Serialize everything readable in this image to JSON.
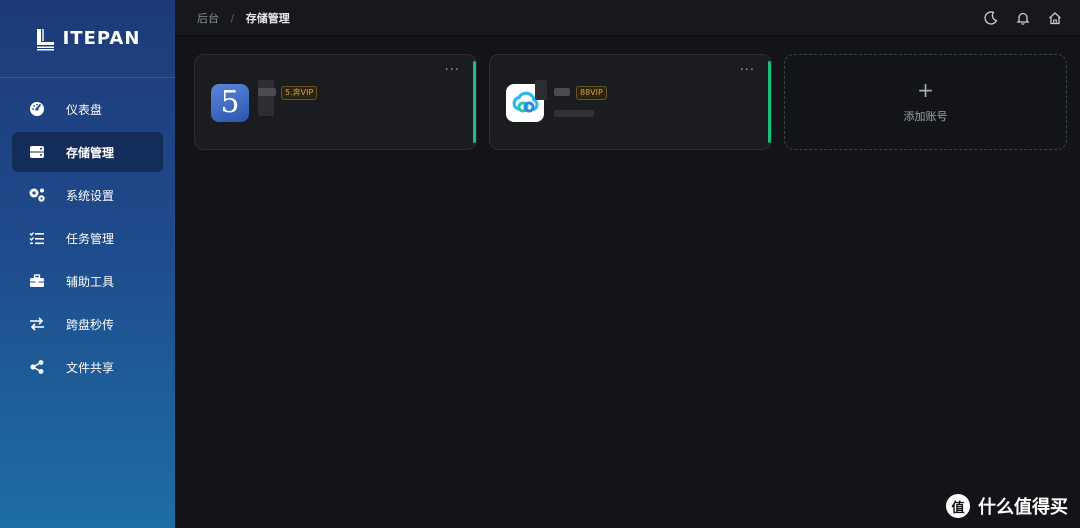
{
  "brand": {
    "logo_text": "ITEPAN"
  },
  "sidebar": {
    "items": [
      {
        "label": "仪表盘",
        "icon": "dashboard-icon",
        "active": false
      },
      {
        "label": "存储管理",
        "icon": "storage-icon",
        "active": true
      },
      {
        "label": "系统设置",
        "icon": "gears-icon",
        "active": false
      },
      {
        "label": "任务管理",
        "icon": "task-list-icon",
        "active": false
      },
      {
        "label": "辅助工具",
        "icon": "toolbox-icon",
        "active": false
      },
      {
        "label": "跨盘秒传",
        "icon": "transfer-icon",
        "active": false
      },
      {
        "label": "文件共享",
        "icon": "share-icon",
        "active": false
      }
    ]
  },
  "header": {
    "breadcrumb": [
      "后台",
      "存储管理"
    ],
    "separator": "/",
    "icons": [
      "moon-icon",
      "bell-icon",
      "home-icon"
    ]
  },
  "accounts": [
    {
      "app": "115",
      "logo_text": "5",
      "badge": "5.奔VIP",
      "more": "···"
    },
    {
      "app": "baidu",
      "badge": "88VIP",
      "more": "···"
    }
  ],
  "add_account": {
    "plus": "+",
    "label": "添加账号"
  },
  "watermark": {
    "icon_text": "值",
    "text": "什么值得买"
  },
  "colors": {
    "accent": "#1dbe7b",
    "sidebar_top": "#1d3a78",
    "sidebar_bottom": "#1d6ea3",
    "badge": "#d6a23c"
  }
}
